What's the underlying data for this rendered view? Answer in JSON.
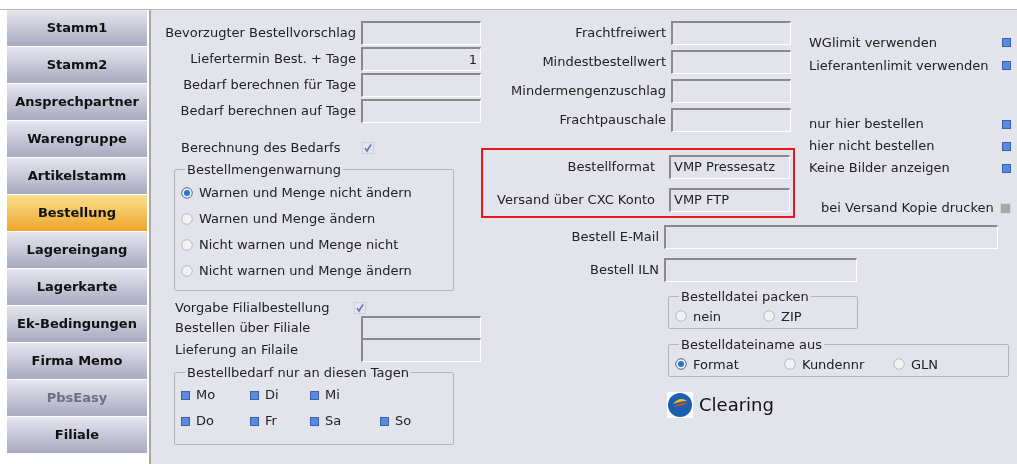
{
  "sidebar": {
    "items": [
      {
        "label": "Stamm1",
        "selected": false,
        "disabled": false
      },
      {
        "label": "Stamm2",
        "selected": false,
        "disabled": false
      },
      {
        "label": "Ansprechpartner",
        "selected": false,
        "disabled": false
      },
      {
        "label": "Warengruppe",
        "selected": false,
        "disabled": false
      },
      {
        "label": "Artikelstamm",
        "selected": false,
        "disabled": false
      },
      {
        "label": "Bestellung",
        "selected": true,
        "disabled": false
      },
      {
        "label": "Lagereingang",
        "selected": false,
        "disabled": false
      },
      {
        "label": "Lagerkarte",
        "selected": false,
        "disabled": false
      },
      {
        "label": "Ek-Bedingungen",
        "selected": false,
        "disabled": false
      },
      {
        "label": "Firma Memo",
        "selected": false,
        "disabled": false
      },
      {
        "label": "PbsEasy",
        "selected": false,
        "disabled": true
      },
      {
        "label": "Filiale",
        "selected": false,
        "disabled": false
      }
    ]
  },
  "left": {
    "fields": [
      {
        "label": "Bevorzugter Bestellvorschlag"
      },
      {
        "label": "Liefertermin Best. + Tage",
        "value": "1"
      },
      {
        "label": "Bedarf berechnen für Tage"
      },
      {
        "label": "Bedarf berechnen auf Tage"
      }
    ],
    "bedarf_check": {
      "label": "Berechnung des Bedarfs",
      "checked": true
    },
    "warnung": {
      "title": "Bestellmengenwarnung",
      "options": [
        {
          "label": "Warnen und Menge nicht ändern",
          "selected": true
        },
        {
          "label": "Warnen und Menge ändern",
          "selected": false
        },
        {
          "label": "Nicht warnen und Menge nicht",
          "selected": false
        },
        {
          "label": "Nicht warnen und Menge ändern",
          "selected": false
        }
      ]
    },
    "filial_check": {
      "label": "Vorgabe Filialbestellung",
      "checked": true
    },
    "filial_fields": [
      {
        "label": "Bestellen über Filiale"
      },
      {
        "label": "Lieferung an Filaile"
      }
    ],
    "days": {
      "title": "Bestellbedarf nur an diesen Tagen",
      "rows": [
        [
          {
            "label": "Mo",
            "checked": true
          },
          {
            "label": "Di",
            "checked": true
          },
          {
            "label": "Mi",
            "checked": true
          }
        ],
        [
          {
            "label": "Do",
            "checked": true
          },
          {
            "label": "Fr",
            "checked": true
          },
          {
            "label": "Sa",
            "checked": true
          },
          {
            "label": "So",
            "checked": true
          }
        ]
      ]
    }
  },
  "middle": {
    "fields": [
      {
        "label": "Frachtfreiwert"
      },
      {
        "label": "Mindestbestellwert"
      },
      {
        "label": "Mindermengenzuschlag"
      },
      {
        "label": "Frachtpauschale"
      }
    ],
    "highlighted_fields": [
      {
        "label": "Bestellformat",
        "value": "VMP Pressesatz"
      },
      {
        "label": "Versand über CXC Konto",
        "value": "VMP FTP"
      }
    ],
    "email": {
      "label": "Bestell E-Mail"
    },
    "iln": {
      "label": "Bestell ILN"
    },
    "packen": {
      "title": "Bestelldatei packen",
      "options": [
        {
          "label": "nein",
          "selected": false
        },
        {
          "label": "ZIP",
          "selected": false
        }
      ]
    },
    "dateiname": {
      "title": "Bestelldateiname aus",
      "options": [
        {
          "label": "Format",
          "selected": true
        },
        {
          "label": "Kundennr",
          "selected": false
        },
        {
          "label": "GLN",
          "selected": false
        }
      ]
    },
    "clearing": {
      "label": "Clearing"
    }
  },
  "right": {
    "options_top": [
      {
        "label": "WGlimit verwenden",
        "checked": true
      },
      {
        "label": "Lieferantenlimit verwenden",
        "checked": true
      }
    ],
    "options_mid": [
      {
        "label": "nur hier bestellen",
        "checked": true
      },
      {
        "label": "hier nicht bestellen",
        "checked": true
      },
      {
        "label": "Keine Bilder anzeigen",
        "checked": true
      }
    ],
    "kopie": {
      "label": "bei Versand Kopie drucken",
      "checked": false
    }
  }
}
